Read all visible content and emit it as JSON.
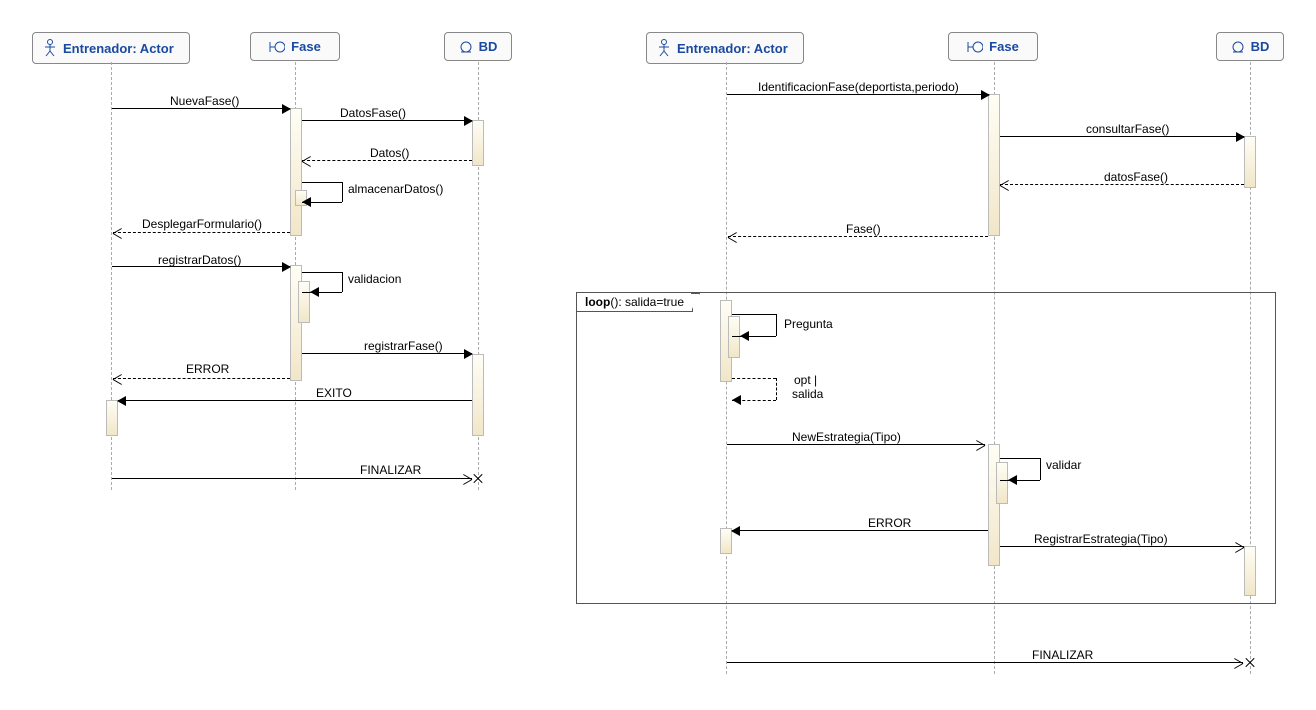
{
  "left": {
    "participants": {
      "entrenador": "Entrenador: Actor",
      "fase": "Fase",
      "bd": "BD"
    },
    "messages": {
      "m1": "NuevaFase()",
      "m2": "DatosFase()",
      "m3": "Datos()",
      "m4": "almacenarDatos()",
      "m5": "DesplegarFormulario()",
      "m6": "registrarDatos()",
      "m7": "validacion",
      "m8": "registrarFase()",
      "m9": "ERROR",
      "m10": "EXITO",
      "m11": "FINALIZAR"
    }
  },
  "right": {
    "participants": {
      "entrenador": "Entrenador: Actor",
      "fase": "Fase",
      "bd": "BD"
    },
    "messages": {
      "m1": "IdentificacionFase(deportista,periodo)",
      "m2": "consultarFase()",
      "m3": "datosFase()",
      "m4": "Fase()",
      "m5": "Pregunta",
      "m6a": "opt |",
      "m6b": "salida",
      "m7": "NewEstrategia(Tipo)",
      "m8": "validar",
      "m9": "ERROR",
      "m10": "RegistrarEstrategia(Tipo)",
      "m11": "FINALIZAR"
    },
    "fragment": {
      "kw": "loop",
      "guard": "(): salida=true"
    }
  }
}
